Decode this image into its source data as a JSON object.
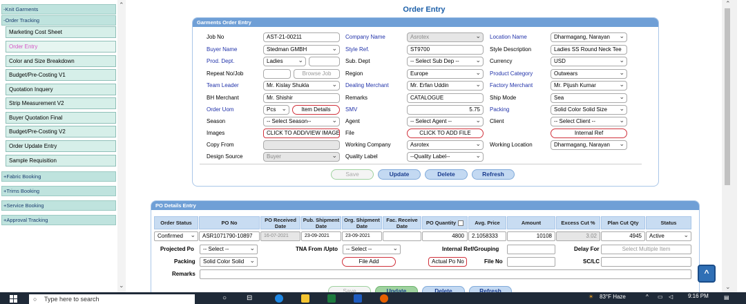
{
  "sidebar": {
    "head1": "-Knit Garments",
    "head2": "-Order Tracking",
    "items": [
      "Marketing Cost Sheet",
      "Order Entry",
      "Color and Size Breakdown",
      "Budget/Pre-Costing V1",
      "Quotation Inquery",
      "Strip Measurement V2",
      "Buyer Quotation Final",
      "Budget/Pre-Costing V2",
      "Order Update Entry",
      "Sample Requisition"
    ],
    "groups": [
      "+Fabric Booking",
      "+Trims Booking",
      "+Service Booking",
      "+Approval Tracking"
    ]
  },
  "page_title": "Order Entry",
  "order_panel": {
    "title": "Garments Order Entry",
    "labels": {
      "job_no": "Job No",
      "buyer_name": "Buyer Name",
      "prod_dept": "Prod. Dept.",
      "repeat_no": "Repeat No/Job",
      "team_leader": "Team Leader",
      "bh_merchant": "BH Merchant",
      "order_uom": "Order Uom",
      "season": "Season",
      "images": "Images",
      "copy_from": "Copy From",
      "design_source": "Design Source",
      "company_name": "Company Name",
      "style_ref": "Style Ref.",
      "sub_dept": "Sub. Dept",
      "region": "Region",
      "dealing_merchant": "Dealing Merchant",
      "remarks": "Remarks",
      "smv": "SMV",
      "agent": "Agent",
      "file": "File",
      "working_company": "Working Company",
      "quality_label": "Quality Label",
      "location_name": "Location Name",
      "style_description": "Style Description",
      "currency": "Currency",
      "product_category": "Product Category",
      "factory_merchant": "Factory Merchant",
      "ship_mode": "Ship Mode",
      "packing": "Packing",
      "client": "Client",
      "working_location": "Working Location"
    },
    "values": {
      "job_no": "AST-21-00211",
      "buyer_name": "Stedman GMBH",
      "prod_dept": "Ladies",
      "browse_job": "Browse Job",
      "team_leader": "Mr. Kislay Shukla",
      "bh_merchant": "Mr. Shishir",
      "order_uom": "Pcs",
      "item_details": "Item Details",
      "season": "-- Select Season--",
      "images": "CLICK TO ADD/VIEW IMAGE",
      "design_source": "Buyer",
      "company_name": "Asrotex",
      "style_ref": "ST9700",
      "sub_dept": "-- Select Sub Dep --",
      "region": "Europe",
      "dealing_merchant": "Mr. Erfan Uddin",
      "remarks": "CATALOGUE",
      "smv": "5.75",
      "agent": "-- Select Agent --",
      "file": "CLICK TO ADD FILE",
      "working_company": "Asrotex",
      "quality_label": "--Quality Label--",
      "location_name": "Dharmagang, Narayan",
      "style_description": "Ladies SS Round Neck Tee",
      "currency": "USD",
      "product_category": "Outwears",
      "factory_merchant": "Mr. Pijush Kumar",
      "ship_mode": "Sea",
      "packing": "Solid Color Solid Size",
      "client": "-- Select Client --",
      "internal_ref": "Internal Ref",
      "working_location": "Dharmagang, Narayan"
    },
    "buttons": {
      "save": "Save",
      "update": "Update",
      "delete": "Delete",
      "refresh": "Refresh"
    }
  },
  "po_panel": {
    "title": "PO Details Entry",
    "headers": [
      "Order Status",
      "PO No",
      "PO Received Date",
      "Pub. Shipment Date",
      "Org. Shipment Date",
      "Fac. Receive Date",
      "PO Quantity",
      "Avg. Price",
      "Amount",
      "Excess Cut %",
      "Plan Cut Qty",
      "Status"
    ],
    "row": {
      "order_status": "Confirmed",
      "po_no": "ASR1071790-10897",
      "po_received": "16-07-2021",
      "pub_shipment": "23-09-2021",
      "org_shipment": "23-09-2021",
      "fac_receive": "",
      "po_quantity": "4800",
      "avg_price": "2.1058333",
      "amount": "10108",
      "excess_cut": "3.02",
      "plan_cut": "4945",
      "status": "Active"
    },
    "labels": {
      "projected_po": "Projected Po",
      "tna_from": "TNA From /Upto",
      "internal_ref": "Internal Ref/Grouping",
      "delay_for": "Delay For",
      "packing": "Packing",
      "file_no": "File No",
      "sc_lc": "SC/LC",
      "remarks": "Remarks"
    },
    "values": {
      "projected_po": "-- Select --",
      "tna_from": "-- Select --",
      "delay_for": "Select Multiple Item",
      "packing": "Solid Color Solid",
      "file_add": "File Add",
      "actual_po": "Actual Po No"
    },
    "buttons": {
      "save": "Save",
      "update": "Update",
      "delete": "Delete",
      "refresh": "Refresh"
    }
  },
  "taskbar": {
    "search": "Type here to search",
    "weather": "83°F  Haze",
    "time": "9:16 PM"
  }
}
